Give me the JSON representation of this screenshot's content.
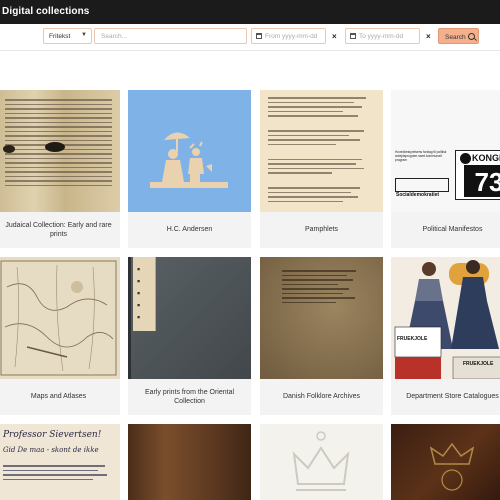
{
  "app": {
    "title": "Digital collections"
  },
  "search": {
    "type_value": "Fritekst",
    "query_placeholder": "Search...",
    "from_placeholder": "From yyyy-mm-dd",
    "to_placeholder": "To yyyy-mm-dd",
    "clear_glyph": "×",
    "button_label": "Search"
  },
  "collections": [
    {
      "label": "Judaical Collection: Early and rare prints"
    },
    {
      "label": "H.C. Andersen"
    },
    {
      "label": "Pamphlets"
    },
    {
      "label": "Political Manifestos"
    },
    {
      "label": "Maps and Atlases"
    },
    {
      "label": "Early prints from the Oriental Collection"
    },
    {
      "label": "Danish Folklore Archives"
    },
    {
      "label": "Department Store Catalogues"
    },
    {
      "label": ""
    },
    {
      "label": ""
    },
    {
      "label": ""
    },
    {
      "label": ""
    }
  ],
  "manifesto_texts": {
    "headline": "KONGRES",
    "number": "73",
    "party": "Socialdemokratiet",
    "booklet": "Hovedbestyrelsens forslag til politisk arbejdsprogram samt kommunalt program"
  },
  "catalogue_texts": {
    "sign": "FRUEKJOLE",
    "sign2": "FRUEKJOLE"
  },
  "letter_texts": {
    "line1": "Professor Sievertsen!",
    "line2": "Gid De maa - skont de ikke"
  }
}
